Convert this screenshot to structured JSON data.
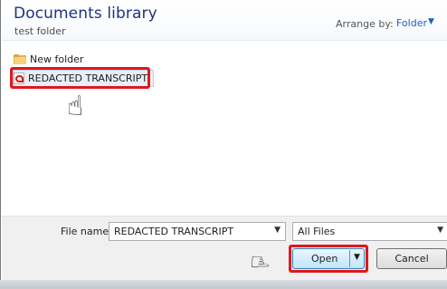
{
  "header": {
    "title": "Documents library",
    "subtitle": "test folder",
    "arrange_label": "Arrange by:",
    "arrange_value": "Folder"
  },
  "files": [
    {
      "name": "New folder",
      "icon": "folder-icon"
    },
    {
      "name": "REDACTED TRANSCRIPT",
      "icon": "pdf-icon",
      "selected": true
    }
  ],
  "footer": {
    "file_name_label": "File name:",
    "file_name_value": "REDACTED TRANSCRIPT",
    "file_type_value": "All Files",
    "open_label": "Open",
    "cancel_label": "Cancel"
  },
  "annotations": {
    "highlight_color": "#e0171c",
    "pointer_icon": "hand-pointer-icon"
  }
}
